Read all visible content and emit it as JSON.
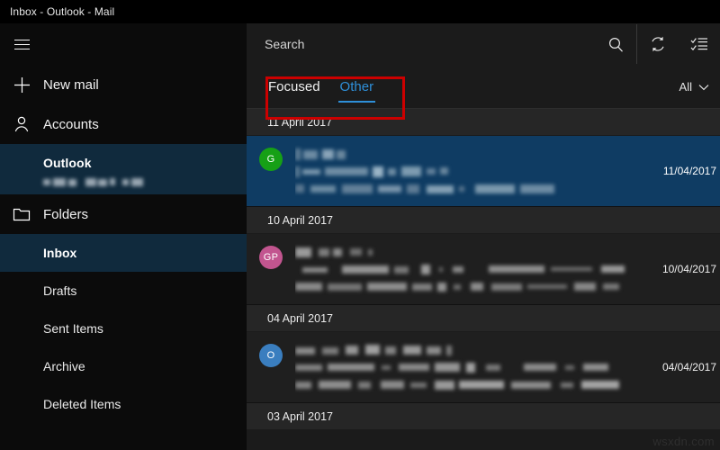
{
  "window": {
    "title": "Inbox - Outlook - Mail"
  },
  "navpane": {
    "menu_icon": "hamburger-icon",
    "new_mail": {
      "label": "New mail",
      "icon": "plus-icon"
    },
    "accounts": {
      "label": "Accounts",
      "icon": "person-icon"
    },
    "account": {
      "name": "Outlook",
      "address_redacted": true
    },
    "folders_header": {
      "label": "Folders",
      "icon": "folder-icon"
    },
    "folders": [
      {
        "label": "Inbox",
        "selected": true
      },
      {
        "label": "Drafts",
        "selected": false
      },
      {
        "label": "Sent Items",
        "selected": false
      },
      {
        "label": "Archive",
        "selected": false
      },
      {
        "label": "Deleted Items",
        "selected": false
      }
    ]
  },
  "toolbar": {
    "search_placeholder": "Search",
    "search_value": "",
    "search_icon": "search-icon",
    "sync_icon": "sync-icon",
    "select_mode_icon": "checklist-icon"
  },
  "tabs": {
    "items": [
      {
        "label": "Focused",
        "active": false
      },
      {
        "label": "Other",
        "active": true
      }
    ],
    "filter": {
      "label": "All",
      "icon": "chevron-down-icon"
    },
    "highlight_color": "#cc0000"
  },
  "message_list": {
    "groups": [
      {
        "date_header": "11 April 2017",
        "messages": [
          {
            "avatar_initials": "G",
            "avatar_color": "#16a016",
            "date": "11/04/2017",
            "selected": true,
            "redacted": true
          }
        ]
      },
      {
        "date_header": "10 April 2017",
        "messages": [
          {
            "avatar_initials": "GP",
            "avatar_color": "#c2558f",
            "date": "10/04/2017",
            "selected": false,
            "redacted": true
          }
        ]
      },
      {
        "date_header": "04 April 2017",
        "messages": [
          {
            "avatar_initials": "O",
            "avatar_color": "#3a7ebf",
            "date": "04/04/2017",
            "selected": false,
            "redacted": true
          }
        ]
      },
      {
        "date_header": "03 April 2017",
        "messages": []
      }
    ]
  },
  "watermark": {
    "text": "wsxdn.com"
  },
  "colors": {
    "accent_blue": "#2e8fd8",
    "selection_blue": "#0f3c63",
    "nav_selected": "#102a3d",
    "annotation_red": "#cc0000"
  }
}
